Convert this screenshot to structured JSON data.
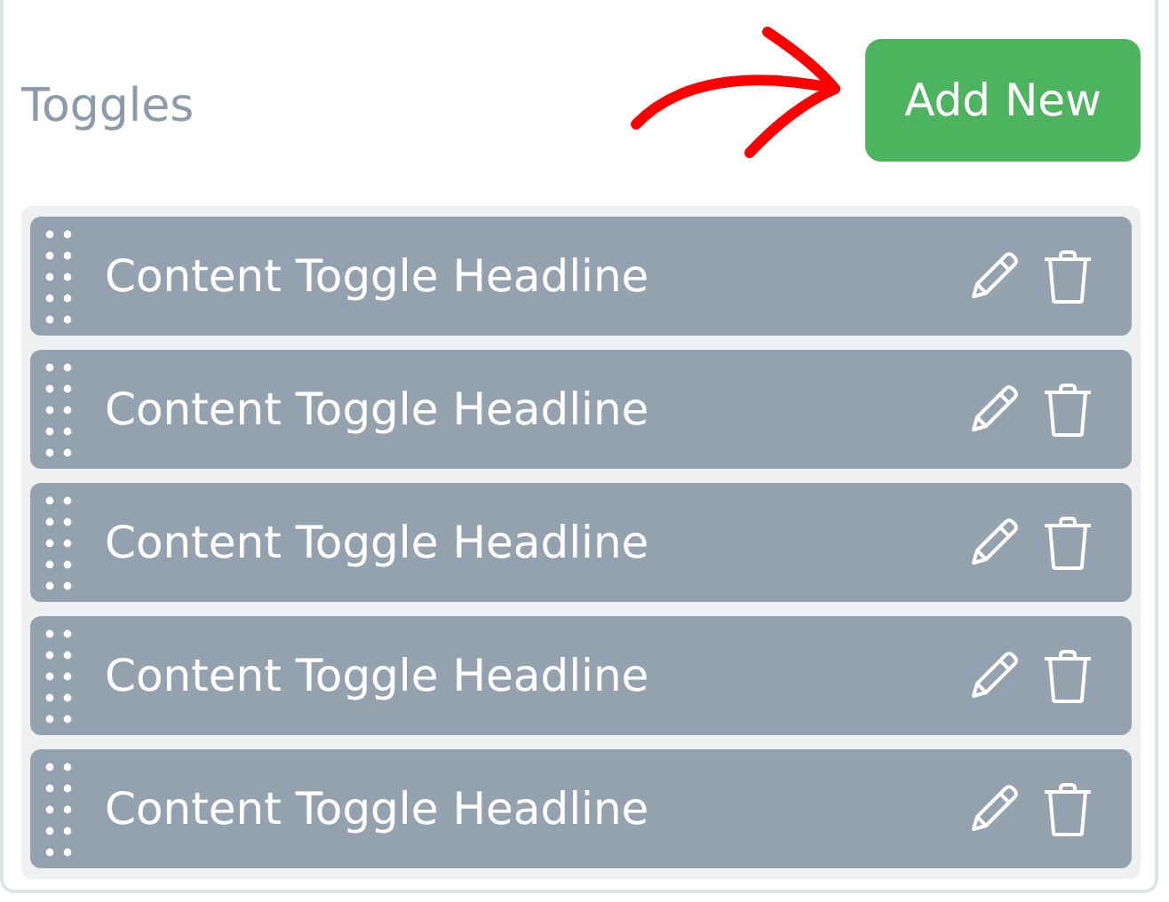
{
  "header": {
    "title": "Toggles",
    "add_button": "Add New"
  },
  "toggles": [
    {
      "headline": "Content Toggle Headline"
    },
    {
      "headline": "Content Toggle Headline"
    },
    {
      "headline": "Content Toggle Headline"
    },
    {
      "headline": "Content Toggle Headline"
    },
    {
      "headline": "Content Toggle Headline"
    }
  ]
}
